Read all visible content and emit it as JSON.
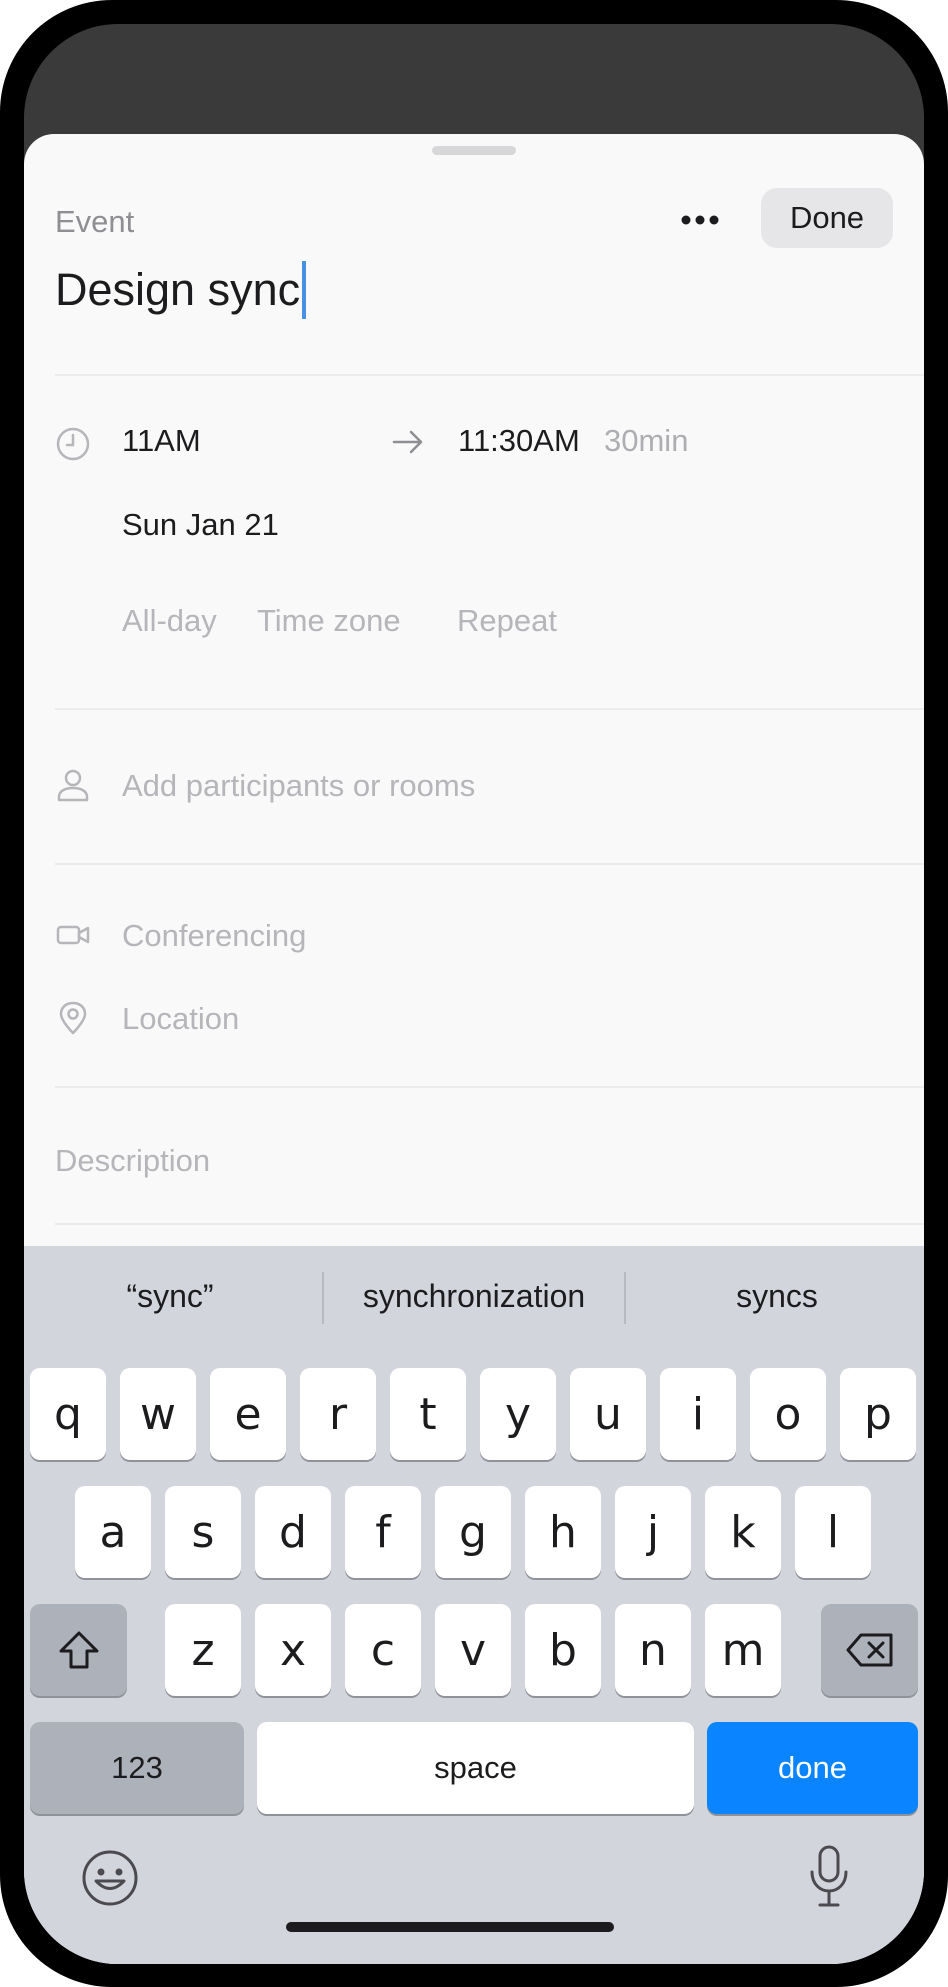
{
  "header": {
    "label": "Event",
    "more_icon": "ellipsis-icon",
    "done_label": "Done"
  },
  "event": {
    "title": "Design sync",
    "start_time": "11AM",
    "end_time": "11:30AM",
    "duration": "30min",
    "date": "Sun Jan 21",
    "options": [
      "All-day",
      "Time zone",
      "Repeat"
    ]
  },
  "fields": {
    "participants_placeholder": "Add participants or rooms",
    "conferencing_placeholder": "Conferencing",
    "location_placeholder": "Location",
    "description_placeholder": "Description"
  },
  "keyboard": {
    "suggestions": [
      "“sync”",
      "synchronization",
      "syncs"
    ],
    "row1": [
      "q",
      "w",
      "e",
      "r",
      "t",
      "y",
      "u",
      "i",
      "o",
      "p"
    ],
    "row2": [
      "a",
      "s",
      "d",
      "f",
      "g",
      "h",
      "j",
      "k",
      "l"
    ],
    "row3": [
      "z",
      "x",
      "c",
      "v",
      "b",
      "n",
      "m"
    ],
    "numbers_label": "123",
    "space_label": "space",
    "done_label": "done",
    "accent_color": "#0a84ff"
  }
}
